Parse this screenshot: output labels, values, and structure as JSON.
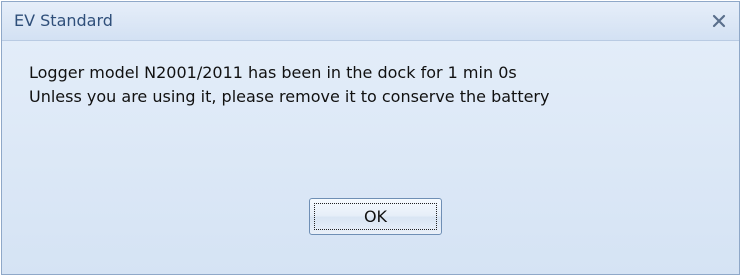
{
  "dialog": {
    "title": "EV Standard",
    "close_icon": "close-icon",
    "message_lines": [
      "Logger model N2001/2011 has been in the dock for 1 min 0s",
      "Unless you are using it, please remove it to conserve the battery"
    ],
    "ok_label": "OK"
  },
  "colors": {
    "title_text": "#2f4f7a",
    "background": "#d6e4f4",
    "border": "#8fa8c8"
  }
}
